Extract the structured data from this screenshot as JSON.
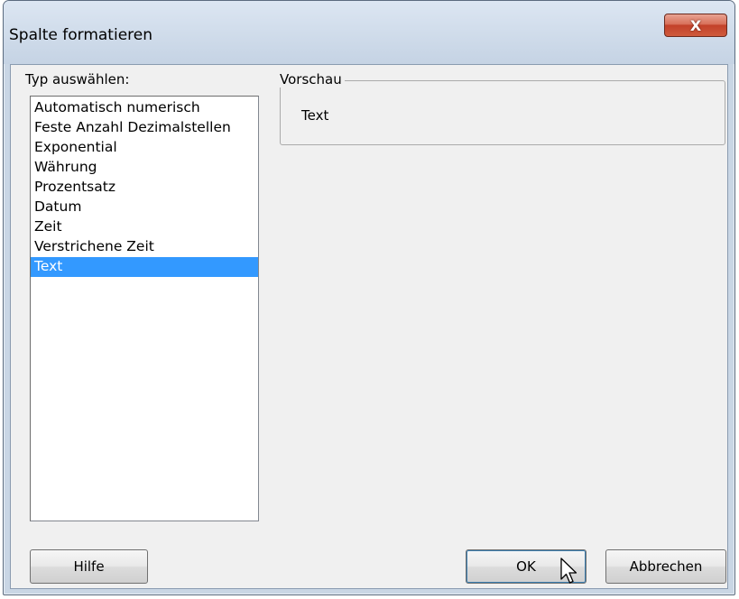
{
  "window": {
    "title": "Spalte formatieren",
    "close_label": "X"
  },
  "type_select": {
    "label": "Typ auswählen:",
    "items": [
      {
        "label": "Automatisch numerisch",
        "selected": false
      },
      {
        "label": "Feste Anzahl Dezimalstellen",
        "selected": false
      },
      {
        "label": "Exponential",
        "selected": false
      },
      {
        "label": "Währung",
        "selected": false
      },
      {
        "label": "Prozentsatz",
        "selected": false
      },
      {
        "label": "Datum",
        "selected": false
      },
      {
        "label": "Zeit",
        "selected": false
      },
      {
        "label": "Verstrichene Zeit",
        "selected": false
      },
      {
        "label": "Text",
        "selected": true
      }
    ]
  },
  "preview": {
    "legend": "Vorschau",
    "value": "Text"
  },
  "buttons": {
    "help": "Hilfe",
    "ok": "OK",
    "cancel": "Abbrechen"
  },
  "colors": {
    "selection": "#3399ff",
    "dialog_background": "#f0f0f0",
    "close_button": "#c2412a"
  },
  "icons": {
    "cursor": "mouse-pointer-icon"
  }
}
